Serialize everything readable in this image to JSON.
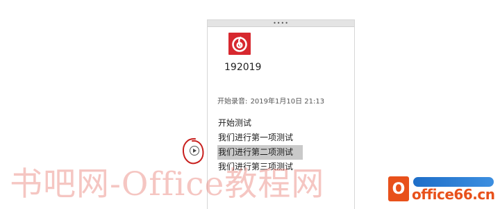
{
  "panel": {
    "handle_glyph": "••••",
    "app_icon": "netease-music-icon",
    "app_name": "192019",
    "recording": {
      "label": "开始录音:",
      "datetime": "2019年1月10日 21:13"
    },
    "transcript": [
      {
        "text": "开始测试",
        "selected": false
      },
      {
        "text": "我们进行第一项测试",
        "selected": false
      },
      {
        "text": "我们进行第二项测试",
        "selected": true
      },
      {
        "text": "我们进行第三项测试",
        "selected": false
      }
    ]
  },
  "controls": {
    "play_icon": "play-circle-icon",
    "annotation_color": "#c8201e"
  },
  "watermark": {
    "text": "书吧网-Office教程网"
  },
  "site_logo": {
    "badge": "O",
    "text": "office66.cn",
    "brand_color": "#e8511b"
  },
  "colors": {
    "app_icon_red": "#d7282f",
    "selection": "#c9c9c9"
  }
}
